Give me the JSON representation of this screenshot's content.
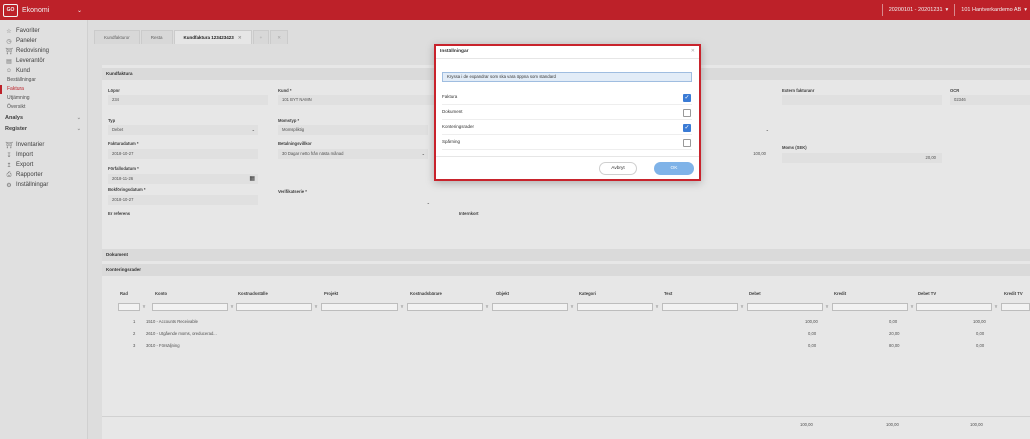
{
  "topbar": {
    "logo": "GO",
    "app_name": "Ekonomi",
    "period": "20200101 - 20201231",
    "company": "101 Hantverkardemo AB"
  },
  "sidebar": {
    "items": [
      {
        "label": "Favoriter",
        "icon": "star-icon"
      },
      {
        "label": "Paneler",
        "icon": "gauge-icon"
      },
      {
        "label": "Redovisning",
        "icon": "bank-icon"
      },
      {
        "label": "Leverantör",
        "icon": "truck-icon"
      },
      {
        "label": "Kund",
        "icon": "user-icon"
      }
    ],
    "sub_items": [
      "Beställningar",
      "Faktura",
      "Utjämning",
      "Översikt"
    ],
    "sections": [
      "Analys",
      "Register"
    ],
    "bottom_items": [
      {
        "label": "Inventarier",
        "icon": "bank-icon"
      },
      {
        "label": "Import",
        "icon": "import-icon"
      },
      {
        "label": "Export",
        "icon": "export-icon"
      },
      {
        "label": "Rapporter",
        "icon": "printer-icon"
      },
      {
        "label": "Inställningar",
        "icon": "gear-icon"
      }
    ]
  },
  "tabs": [
    {
      "label": "Kundfakturor"
    },
    {
      "label": "Resta"
    },
    {
      "label": "Kundfaktura 123423423"
    }
  ],
  "form": {
    "section_title": "Kundfaktura",
    "lopnr_label": "Löpnr",
    "lopnr_value": "234",
    "kund_label": "Kund *",
    "kund_value": "101 BYT NAMN",
    "ext_label": "Extern fakturanr",
    "ocr_label": "OCR",
    "ocr_value": "02346",
    "typ_label": "Typ",
    "typ_value": "Debet",
    "momstyp_label": "Momstyp *",
    "momstyp_value": "Momspliktig",
    "fakturadatum_label": "Fakturadatum *",
    "fakturadatum_value": "2018-10-27",
    "betvillkor_label": "Betalningsvillkor",
    "betvillkor_value": "30 Dagar netto från nästa månad",
    "sum_value": "100,00",
    "moms_label": "Moms (SEK)",
    "moms_value": "20,00",
    "forfall_label": "Förfallodatum *",
    "forfall_value": "2018-11-26",
    "bokf_label": "Bokföringsdatum *",
    "bokf_value": "2018-10-27",
    "verifikat_label": "Verifikatserie *",
    "erref_label": "Er referens",
    "intern_label": "Internkort"
  },
  "sections": {
    "dokument": "Dokument",
    "kontering": "Konteringsrader"
  },
  "grid": {
    "columns": [
      "Rad",
      "Konto",
      "Kostnadsställe",
      "Projekt",
      "Kostnadsbärare",
      "Objekt",
      "Kategori",
      "Text",
      "Debet",
      "Kredit",
      "Debet TV",
      "Kredit TV"
    ],
    "rows": [
      {
        "rad": "1",
        "konto": "1510 - Accounts Receivable",
        "debet": "100,00",
        "kredit": "0,00",
        "debet_tv": "100,00"
      },
      {
        "rad": "2",
        "konto": "2610 - Utgående moms, oreducerad...",
        "debet": "0,00",
        "kredit": "20,00",
        "debet_tv": "0,00"
      },
      {
        "rad": "3",
        "konto": "3010 - Försäljning",
        "debet": "0,00",
        "kredit": "80,00",
        "debet_tv": "0,00"
      }
    ],
    "totals": {
      "debet": "100,00",
      "kredit": "100,00",
      "debet_tv": "100,00"
    }
  },
  "modal": {
    "title": "Inställningar",
    "info": "Kryssa i de expandrar som ska vara öppna som standard",
    "options": [
      {
        "label": "Faktura",
        "checked": true
      },
      {
        "label": "Dokument",
        "checked": false
      },
      {
        "label": "Konteringsrader",
        "checked": true
      },
      {
        "label": "Spårning",
        "checked": false
      }
    ],
    "cancel": "Avbryt",
    "ok": "OK"
  },
  "colors": {
    "brand": "#c8232c",
    "accent": "#3a7bd5"
  }
}
